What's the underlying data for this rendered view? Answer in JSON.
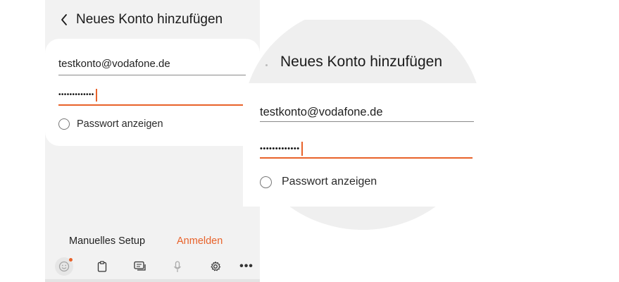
{
  "header": {
    "title": "Neues Konto hinzufügen",
    "back_icon": "chevron-left-icon"
  },
  "form": {
    "email_value": "testkonto@vodafone.de",
    "password_mask": "•••••••••••••",
    "show_password_label": "Passwort anzeigen",
    "show_password_checked": false
  },
  "actions": {
    "manual_setup_label": "Manuelles Setup",
    "login_label": "Anmelden"
  },
  "keyboard_toolbar": {
    "icons": [
      "emoji-icon",
      "clipboard-icon",
      "chat-icon",
      "microphone-icon",
      "gear-icon",
      "more-icon"
    ],
    "more_glyph": "•••"
  },
  "colors": {
    "accent": "#e8622a",
    "background": "#f2f2f2",
    "card": "#ffffff"
  }
}
